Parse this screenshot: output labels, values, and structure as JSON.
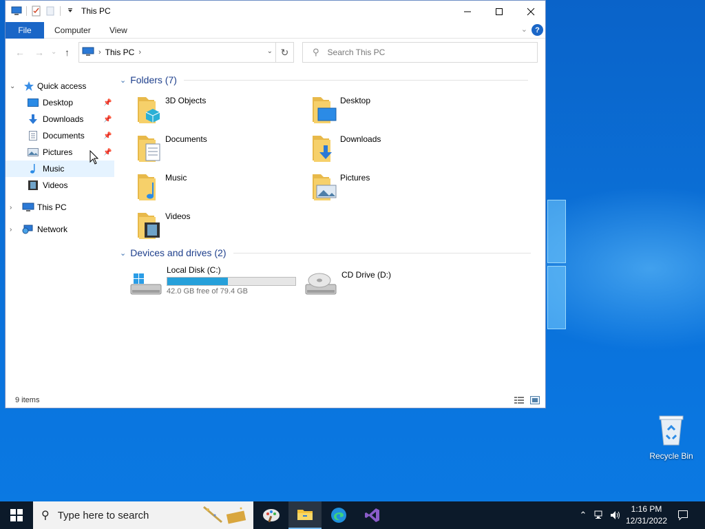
{
  "window": {
    "title": "This PC",
    "ribbon_tabs": [
      "File",
      "Computer",
      "View"
    ],
    "help_label": "?"
  },
  "navigation": {
    "address_path": "This PC",
    "search_placeholder": "Search This PC"
  },
  "nav_pane": {
    "quick_access": "Quick access",
    "quick_items": [
      {
        "label": "Desktop",
        "icon": "desktop-icon",
        "pinned": true
      },
      {
        "label": "Downloads",
        "icon": "downloads-icon",
        "pinned": true
      },
      {
        "label": "Documents",
        "icon": "documents-icon",
        "pinned": true
      },
      {
        "label": "Pictures",
        "icon": "pictures-icon",
        "pinned": true
      },
      {
        "label": "Music",
        "icon": "music-icon",
        "pinned": false
      },
      {
        "label": "Videos",
        "icon": "videos-icon",
        "pinned": false
      }
    ],
    "this_pc": "This PC",
    "network": "Network"
  },
  "content": {
    "folders_header": "Folders (7)",
    "folders": [
      {
        "label": "3D Objects",
        "icon": "3d-objects-folder-icon"
      },
      {
        "label": "Desktop",
        "icon": "desktop-folder-icon"
      },
      {
        "label": "Documents",
        "icon": "documents-folder-icon"
      },
      {
        "label": "Downloads",
        "icon": "downloads-folder-icon"
      },
      {
        "label": "Music",
        "icon": "music-folder-icon"
      },
      {
        "label": "Pictures",
        "icon": "pictures-folder-icon"
      },
      {
        "label": "Videos",
        "icon": "videos-folder-icon"
      }
    ],
    "drives_header": "Devices and drives (2)",
    "drives": [
      {
        "label": "Local Disk (C:)",
        "free_text": "42.0 GB free of 79.4 GB",
        "used_fraction": 0.471
      },
      {
        "label": "CD Drive (D:)"
      }
    ]
  },
  "status": {
    "items": "9 items"
  },
  "desktop": {
    "recycle_bin": "Recycle Bin"
  },
  "taskbar": {
    "search_text": "Type here to search",
    "time": "1:16 PM",
    "date": "12/31/2022"
  },
  "colors": {
    "accent": "#1a66c7",
    "drive_bar": "#26a0da",
    "folder_yellow": "#f6d06a",
    "group_header": "#1e3f8c"
  }
}
